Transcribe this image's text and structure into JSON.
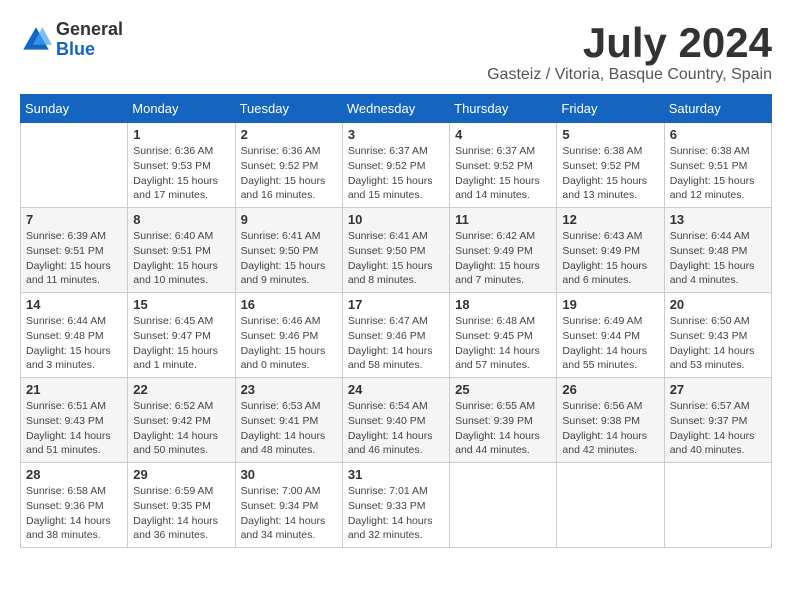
{
  "header": {
    "logo_line1": "General",
    "logo_line2": "Blue",
    "title": "July 2024",
    "subtitle": "Gasteiz / Vitoria, Basque Country, Spain"
  },
  "weekdays": [
    "Sunday",
    "Monday",
    "Tuesday",
    "Wednesday",
    "Thursday",
    "Friday",
    "Saturday"
  ],
  "weeks": [
    [
      {
        "day": "",
        "sunrise": "",
        "sunset": "",
        "daylight": ""
      },
      {
        "day": "1",
        "sunrise": "Sunrise: 6:36 AM",
        "sunset": "Sunset: 9:53 PM",
        "daylight": "Daylight: 15 hours and 17 minutes."
      },
      {
        "day": "2",
        "sunrise": "Sunrise: 6:36 AM",
        "sunset": "Sunset: 9:52 PM",
        "daylight": "Daylight: 15 hours and 16 minutes."
      },
      {
        "day": "3",
        "sunrise": "Sunrise: 6:37 AM",
        "sunset": "Sunset: 9:52 PM",
        "daylight": "Daylight: 15 hours and 15 minutes."
      },
      {
        "day": "4",
        "sunrise": "Sunrise: 6:37 AM",
        "sunset": "Sunset: 9:52 PM",
        "daylight": "Daylight: 15 hours and 14 minutes."
      },
      {
        "day": "5",
        "sunrise": "Sunrise: 6:38 AM",
        "sunset": "Sunset: 9:52 PM",
        "daylight": "Daylight: 15 hours and 13 minutes."
      },
      {
        "day": "6",
        "sunrise": "Sunrise: 6:38 AM",
        "sunset": "Sunset: 9:51 PM",
        "daylight": "Daylight: 15 hours and 12 minutes."
      }
    ],
    [
      {
        "day": "7",
        "sunrise": "Sunrise: 6:39 AM",
        "sunset": "Sunset: 9:51 PM",
        "daylight": "Daylight: 15 hours and 11 minutes."
      },
      {
        "day": "8",
        "sunrise": "Sunrise: 6:40 AM",
        "sunset": "Sunset: 9:51 PM",
        "daylight": "Daylight: 15 hours and 10 minutes."
      },
      {
        "day": "9",
        "sunrise": "Sunrise: 6:41 AM",
        "sunset": "Sunset: 9:50 PM",
        "daylight": "Daylight: 15 hours and 9 minutes."
      },
      {
        "day": "10",
        "sunrise": "Sunrise: 6:41 AM",
        "sunset": "Sunset: 9:50 PM",
        "daylight": "Daylight: 15 hours and 8 minutes."
      },
      {
        "day": "11",
        "sunrise": "Sunrise: 6:42 AM",
        "sunset": "Sunset: 9:49 PM",
        "daylight": "Daylight: 15 hours and 7 minutes."
      },
      {
        "day": "12",
        "sunrise": "Sunrise: 6:43 AM",
        "sunset": "Sunset: 9:49 PM",
        "daylight": "Daylight: 15 hours and 6 minutes."
      },
      {
        "day": "13",
        "sunrise": "Sunrise: 6:44 AM",
        "sunset": "Sunset: 9:48 PM",
        "daylight": "Daylight: 15 hours and 4 minutes."
      }
    ],
    [
      {
        "day": "14",
        "sunrise": "Sunrise: 6:44 AM",
        "sunset": "Sunset: 9:48 PM",
        "daylight": "Daylight: 15 hours and 3 minutes."
      },
      {
        "day": "15",
        "sunrise": "Sunrise: 6:45 AM",
        "sunset": "Sunset: 9:47 PM",
        "daylight": "Daylight: 15 hours and 1 minute."
      },
      {
        "day": "16",
        "sunrise": "Sunrise: 6:46 AM",
        "sunset": "Sunset: 9:46 PM",
        "daylight": "Daylight: 15 hours and 0 minutes."
      },
      {
        "day": "17",
        "sunrise": "Sunrise: 6:47 AM",
        "sunset": "Sunset: 9:46 PM",
        "daylight": "Daylight: 14 hours and 58 minutes."
      },
      {
        "day": "18",
        "sunrise": "Sunrise: 6:48 AM",
        "sunset": "Sunset: 9:45 PM",
        "daylight": "Daylight: 14 hours and 57 minutes."
      },
      {
        "day": "19",
        "sunrise": "Sunrise: 6:49 AM",
        "sunset": "Sunset: 9:44 PM",
        "daylight": "Daylight: 14 hours and 55 minutes."
      },
      {
        "day": "20",
        "sunrise": "Sunrise: 6:50 AM",
        "sunset": "Sunset: 9:43 PM",
        "daylight": "Daylight: 14 hours and 53 minutes."
      }
    ],
    [
      {
        "day": "21",
        "sunrise": "Sunrise: 6:51 AM",
        "sunset": "Sunset: 9:43 PM",
        "daylight": "Daylight: 14 hours and 51 minutes."
      },
      {
        "day": "22",
        "sunrise": "Sunrise: 6:52 AM",
        "sunset": "Sunset: 9:42 PM",
        "daylight": "Daylight: 14 hours and 50 minutes."
      },
      {
        "day": "23",
        "sunrise": "Sunrise: 6:53 AM",
        "sunset": "Sunset: 9:41 PM",
        "daylight": "Daylight: 14 hours and 48 minutes."
      },
      {
        "day": "24",
        "sunrise": "Sunrise: 6:54 AM",
        "sunset": "Sunset: 9:40 PM",
        "daylight": "Daylight: 14 hours and 46 minutes."
      },
      {
        "day": "25",
        "sunrise": "Sunrise: 6:55 AM",
        "sunset": "Sunset: 9:39 PM",
        "daylight": "Daylight: 14 hours and 44 minutes."
      },
      {
        "day": "26",
        "sunrise": "Sunrise: 6:56 AM",
        "sunset": "Sunset: 9:38 PM",
        "daylight": "Daylight: 14 hours and 42 minutes."
      },
      {
        "day": "27",
        "sunrise": "Sunrise: 6:57 AM",
        "sunset": "Sunset: 9:37 PM",
        "daylight": "Daylight: 14 hours and 40 minutes."
      }
    ],
    [
      {
        "day": "28",
        "sunrise": "Sunrise: 6:58 AM",
        "sunset": "Sunset: 9:36 PM",
        "daylight": "Daylight: 14 hours and 38 minutes."
      },
      {
        "day": "29",
        "sunrise": "Sunrise: 6:59 AM",
        "sunset": "Sunset: 9:35 PM",
        "daylight": "Daylight: 14 hours and 36 minutes."
      },
      {
        "day": "30",
        "sunrise": "Sunrise: 7:00 AM",
        "sunset": "Sunset: 9:34 PM",
        "daylight": "Daylight: 14 hours and 34 minutes."
      },
      {
        "day": "31",
        "sunrise": "Sunrise: 7:01 AM",
        "sunset": "Sunset: 9:33 PM",
        "daylight": "Daylight: 14 hours and 32 minutes."
      },
      {
        "day": "",
        "sunrise": "",
        "sunset": "",
        "daylight": ""
      },
      {
        "day": "",
        "sunrise": "",
        "sunset": "",
        "daylight": ""
      },
      {
        "day": "",
        "sunrise": "",
        "sunset": "",
        "daylight": ""
      }
    ]
  ]
}
